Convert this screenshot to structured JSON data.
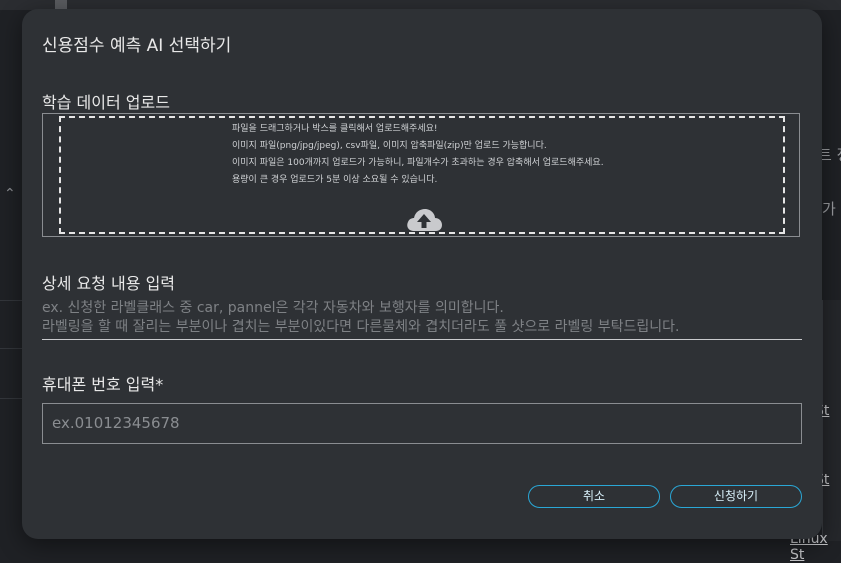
{
  "background": {
    "right_texts": [
      "트 정",
      "가"
    ],
    "row_links": [
      "St",
      "St",
      "Linux St"
    ]
  },
  "modal": {
    "title": "신용점수 예측 AI 선택하기",
    "upload": {
      "label": "학습 데이터 업로드",
      "lines": [
        "파일을 드래그하거나 박스를 클릭해서 업로드해주세요!",
        "이미지 파일(png/jpg/jpeg), csv파일, 이미지 압축파일(zip)만 업로드 가능합니다.",
        "이미지 파일은 100개까지 업로드가 가능하니, 파일개수가 초과하는 경우 압축해서 업로드해주세요.",
        "용량이 큰 경우 업로드가 5분 이상 소요될 수 있습니다."
      ],
      "icon": "cloud-upload-icon"
    },
    "detail": {
      "label": "상세 요청 내용 입력",
      "placeholder_lines": [
        "ex. 신청한 라벨클래스 중 car, pannel은 각각 자동차와 보행자를 의미합니다.",
        "라벨링을 할 때 잘리는 부분이나 겹치는 부분이있다면 다른물체와 겹치더라도 풀 샷으로 라벨링 부탁드립니다."
      ]
    },
    "phone": {
      "label": "휴대폰 번호 입력*",
      "placeholder": "ex.01012345678"
    },
    "buttons": {
      "cancel": "취소",
      "submit": "신청하기"
    }
  },
  "colors": {
    "modal_bg": "#2e3135",
    "accent": "#2aa7d6",
    "backdrop": "#1f2125"
  }
}
